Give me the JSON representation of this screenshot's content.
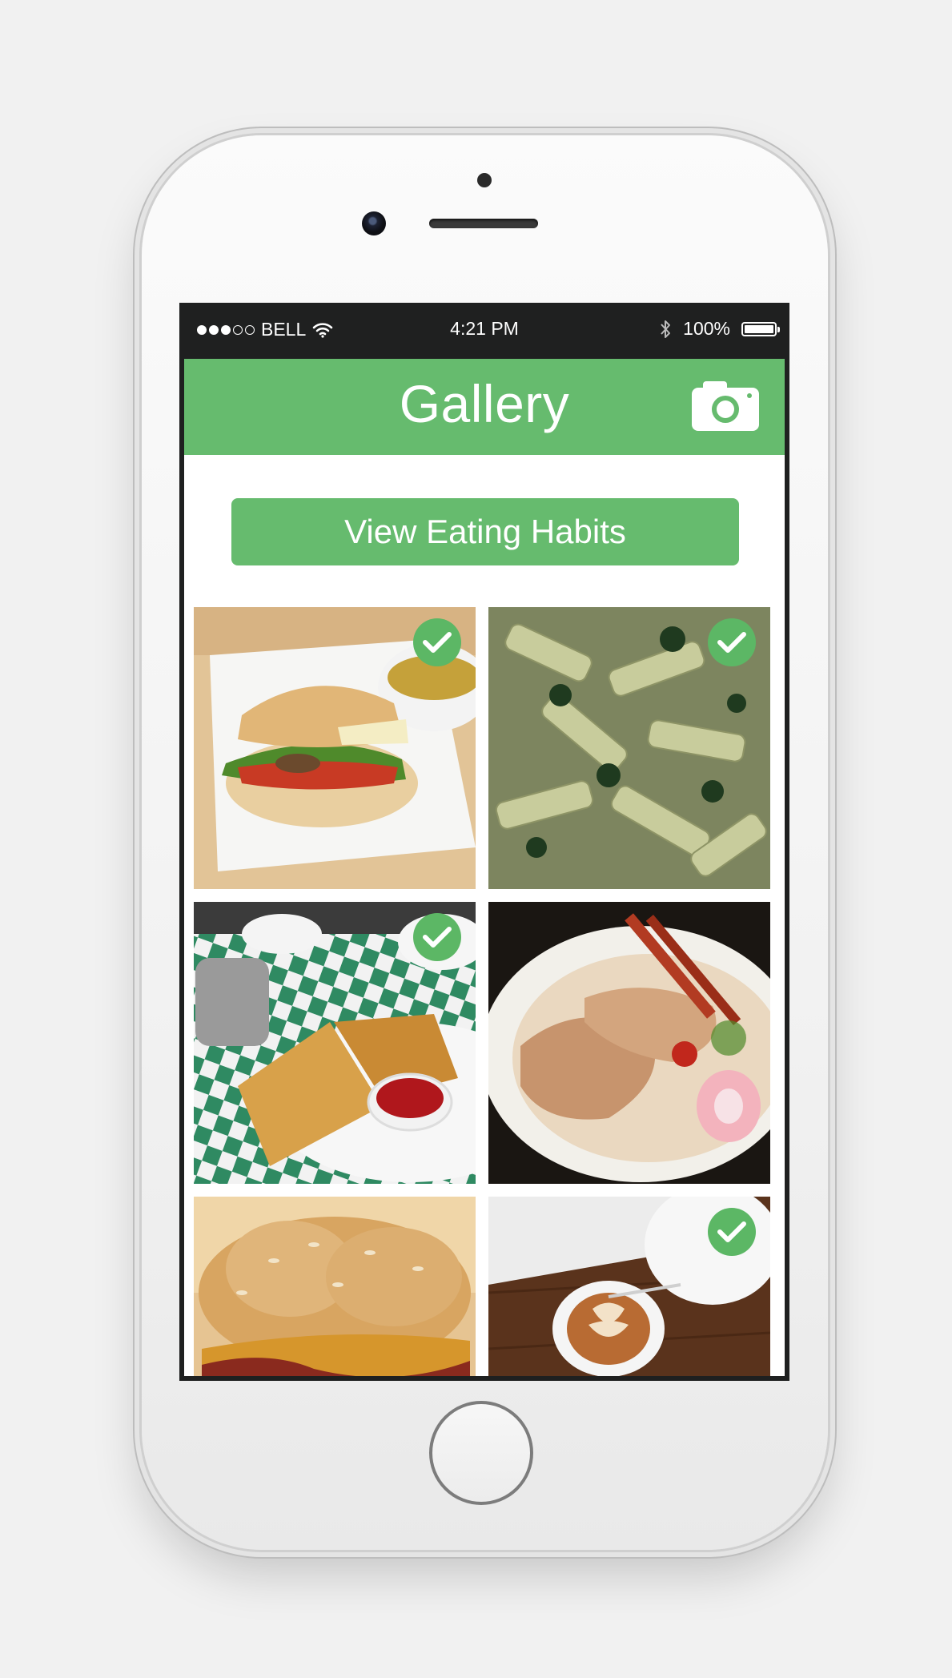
{
  "status_bar": {
    "carrier": "BELL",
    "time": "4:21 PM",
    "battery": "100%",
    "signal_bars_filled": 3,
    "signal_bars_total": 5
  },
  "header": {
    "title": "Gallery",
    "camera_icon": "camera-icon"
  },
  "actions": {
    "view_habits_label": "View Eating Habits"
  },
  "gallery": {
    "items": [
      {
        "subject": "sandwich-with-soup",
        "checked": true
      },
      {
        "subject": "penne-pasta",
        "checked": true
      },
      {
        "subject": "grilled-cheese-with-ketchup",
        "checked": true
      },
      {
        "subject": "ramen-bowl",
        "checked": false
      },
      {
        "subject": "burger",
        "checked": false
      },
      {
        "subject": "latte-coffee",
        "checked": true
      }
    ]
  },
  "colors": {
    "accent": "#66bb6e",
    "status_bar": "#1f2020",
    "background": "#ffffff"
  }
}
